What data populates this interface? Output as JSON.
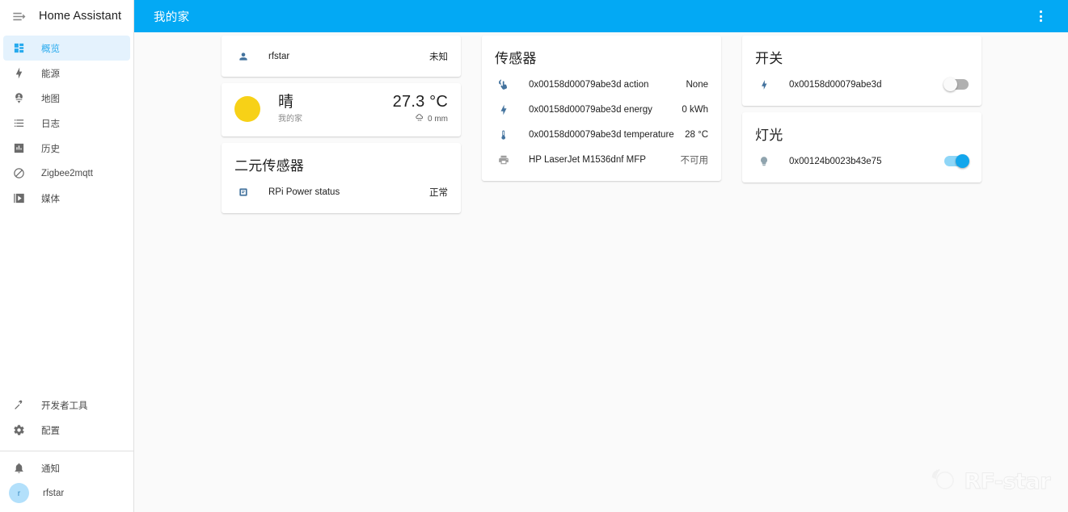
{
  "sidebar": {
    "title": "Home Assistant",
    "menu_icon": "menu-open-icon",
    "items": [
      {
        "label": "概览",
        "icon": "view-dashboard-icon",
        "active": true
      },
      {
        "label": "能源",
        "icon": "lightning-bolt-icon",
        "active": false
      },
      {
        "label": "地图",
        "icon": "map-marker-account-icon",
        "active": false
      },
      {
        "label": "日志",
        "icon": "format-list-bulleted-icon",
        "active": false
      },
      {
        "label": "历史",
        "icon": "chart-box-icon",
        "active": false
      },
      {
        "label": "Zigbee2mqtt",
        "icon": "zigbee-icon",
        "active": false
      },
      {
        "label": "媒体",
        "icon": "play-box-icon",
        "active": false
      }
    ],
    "tools": [
      {
        "label": "开发者工具",
        "icon": "hammer-icon"
      },
      {
        "label": "配置",
        "icon": "gear-icon"
      }
    ],
    "footer": [
      {
        "label": "通知",
        "icon": "bell-icon"
      }
    ],
    "user": {
      "label": "rfstar",
      "initial": "r"
    }
  },
  "topbar": {
    "title": "我的家",
    "overflow_icon": "dots-vertical-icon"
  },
  "colors": {
    "accent": "#03a9f4",
    "sidebar_active_bg": "#e4f2fd",
    "sidebar_active_fg": "#27aaee",
    "entity_icon": "#44739e",
    "sun": "#f7d117",
    "toggle_on": "#13a6ec",
    "toggle_off": "#b0b0b0",
    "background": "#fafafa"
  },
  "columns": [
    {
      "cards": [
        {
          "type": "entities",
          "title": null,
          "rows": [
            {
              "icon": "account-icon",
              "name": "rfstar",
              "value": "未知",
              "muted_icon": false,
              "muted_value": false
            }
          ]
        },
        {
          "type": "weather",
          "state": "晴",
          "location": "我的家",
          "temperature": "27.3 °C",
          "precipitation": "0 mm",
          "sun_icon": "weather-sunny-icon",
          "rain_icon": "weather-pouring-icon"
        },
        {
          "type": "entities",
          "title": "二元传感器",
          "rows": [
            {
              "icon": "chip-icon",
              "name": "RPi Power status",
              "value": "正常",
              "muted_icon": false,
              "muted_value": false
            }
          ]
        }
      ]
    },
    {
      "cards": [
        {
          "type": "entities",
          "title": "传感器",
          "rows": [
            {
              "icon": "gesture-tap-icon",
              "name": "0x00158d00079abe3d action",
              "value": "None",
              "muted_icon": false,
              "muted_value": false
            },
            {
              "icon": "lightning-bolt-icon",
              "name": "0x00158d00079abe3d energy",
              "value": "0 kWh",
              "muted_icon": false,
              "muted_value": false
            },
            {
              "icon": "thermometer-icon",
              "name": "0x00158d00079abe3d temperature",
              "value": "28 °C",
              "muted_icon": false,
              "muted_value": false
            },
            {
              "icon": "printer-icon",
              "name": "HP LaserJet M1536dnf MFP",
              "value": "不可用",
              "muted_icon": true,
              "muted_value": true
            }
          ]
        }
      ]
    },
    {
      "cards": [
        {
          "type": "toggles",
          "title": "开关",
          "rows": [
            {
              "icon": "flash-icon",
              "name": "0x00158d00079abe3d",
              "on": false,
              "muted_icon": false
            }
          ]
        },
        {
          "type": "toggles",
          "title": "灯光",
          "rows": [
            {
              "icon": "lightbulb-icon",
              "name": "0x00124b0023b43e75",
              "on": true,
              "muted_icon": true
            }
          ]
        }
      ]
    }
  ],
  "watermark": {
    "text": "RF-star",
    "icon": "rf-star-logo-icon"
  }
}
